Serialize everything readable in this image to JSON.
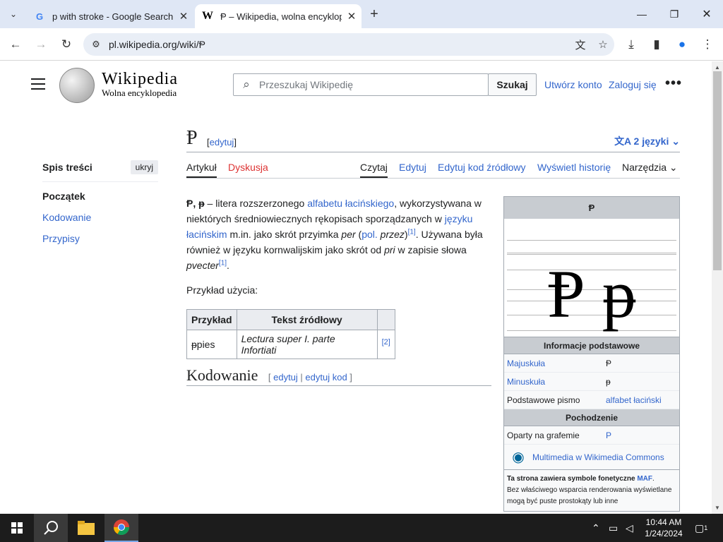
{
  "browser": {
    "tabs": [
      {
        "title": "p with stroke - Google Search"
      },
      {
        "title": "Ᵽ – Wikipedia, wolna encyklopedia"
      }
    ],
    "address": "pl.wikipedia.org/wiki/Ᵽ"
  },
  "wiki": {
    "wordmark": "Wikipedia",
    "tagline": "Wolna encyklopedia",
    "search_placeholder": "Przeszukaj Wikipedię",
    "search_button": "Szukaj",
    "create_account": "Utwórz konto",
    "login": "Zaloguj się"
  },
  "toc": {
    "title": "Spis treści",
    "hide": "ukryj",
    "items": [
      "Początek",
      "Kodowanie",
      "Przypisy"
    ]
  },
  "article": {
    "title": "Ᵽ",
    "edit_link": "edytuj",
    "languages": "2 języki",
    "tabs": {
      "article": "Artykuł",
      "discussion": "Dyskusja",
      "read": "Czytaj",
      "edit": "Edytuj",
      "edit_source": "Edytuj kod źródłowy",
      "history": "Wyświetl historię",
      "tools": "Narzędzia"
    },
    "intro": {
      "letters": "Ᵽ, ᵽ",
      "t1": " – litera rozszerzonego ",
      "l1": "alfabetu łacińskiego",
      "t2": ", wykorzystywana w niektórych średniowiecznych rękopisach sporządzanych w ",
      "l2": "języku łacińskim",
      "t3": " m.in. jako skrót przyimka ",
      "i1": "per",
      "t4": " (",
      "l3": "pol.",
      "i2": "przez",
      "t5": ")",
      "ref1": "[1]",
      "t6": ". Używana była również w języku kornwalijskim jako skrót od ",
      "i3": "pri",
      "t7": " w zapisie słowa ",
      "i4": "pvecter",
      "ref2": "[1]",
      "t8": "."
    },
    "usage_label": "Przykład użycia:",
    "table": {
      "headers": [
        "Przykład",
        "Tekst źródłowy",
        ""
      ],
      "row": {
        "example": "ᵽpies",
        "source": "Lectura super I. parte Infortiati",
        "ref": "[2]"
      }
    },
    "section2": {
      "title": "Kodowanie",
      "open": "[ ",
      "edit": "edytuj",
      "sep": " | ",
      "edit_source": "edytuj kod",
      "close": " ]"
    }
  },
  "infobox": {
    "title": "Ᵽ",
    "glyph": "Ᵽ ᵽ",
    "basic_header": "Informacje podstawowe",
    "rows": [
      {
        "key": "Majuskuła",
        "value": "Ᵽ"
      },
      {
        "key": "Minuskuła",
        "value": "ᵽ"
      },
      {
        "key": "Podstawowe pismo",
        "value": "alfabet łaciński"
      }
    ],
    "origin_header": "Pochodzenie",
    "origin_row": {
      "key": "Oparty na grafemie",
      "value": "P"
    },
    "commons": "Multimedia w Wikimedia Commons",
    "note_bold": "Ta strona zawiera symbole fonetyczne ",
    "note_link": "MAF",
    "note_rest": "Bez właściwego wsparcia renderowania wyświetlane mogą być puste prostokąty lub inne"
  },
  "taskbar": {
    "time": "10:44 AM",
    "date": "1/24/2024",
    "notifications": "1"
  }
}
